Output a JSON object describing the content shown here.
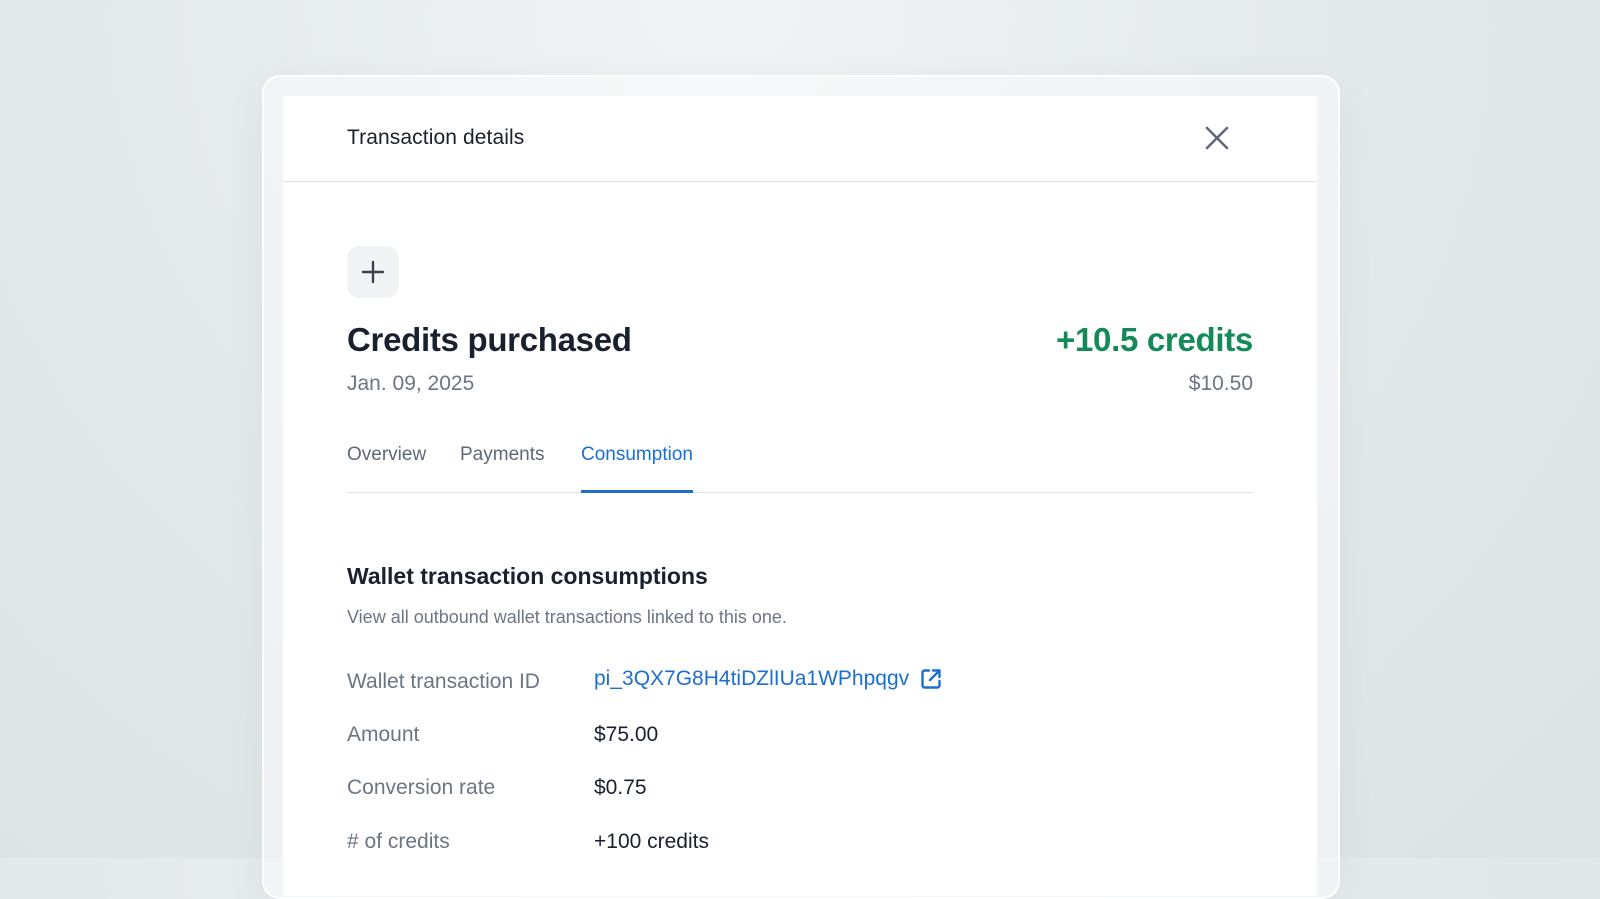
{
  "panel": {
    "title": "Transaction details"
  },
  "transaction": {
    "title": "Credits purchased",
    "date": "Jan. 09, 2025",
    "credits": "+10.5 credits",
    "price": "$10.50"
  },
  "tabs": [
    {
      "label": "Overview",
      "active": false
    },
    {
      "label": "Payments",
      "active": false
    },
    {
      "label": "Consumption",
      "active": true
    }
  ],
  "consumption": {
    "title": "Wallet transaction consumptions",
    "description": "View all outbound wallet transactions linked to this one.",
    "rows": [
      {
        "label": "Wallet transaction ID",
        "value": "pi_3QX7G8H4tiDZlIUa1WPhpqgv"
      },
      {
        "label": "Amount",
        "value": "$75.00"
      },
      {
        "label": "Conversion rate",
        "value": "$0.75"
      },
      {
        "label": "# of credits",
        "value": "+100 credits"
      }
    ]
  },
  "icons": {
    "close": "close-icon",
    "plus": "plus-icon",
    "external_link": "external-link-icon"
  },
  "colors": {
    "accent": "#1c6fd1",
    "positive": "#138a57",
    "muted_text": "#6b7584",
    "primary_text": "#19212e"
  }
}
